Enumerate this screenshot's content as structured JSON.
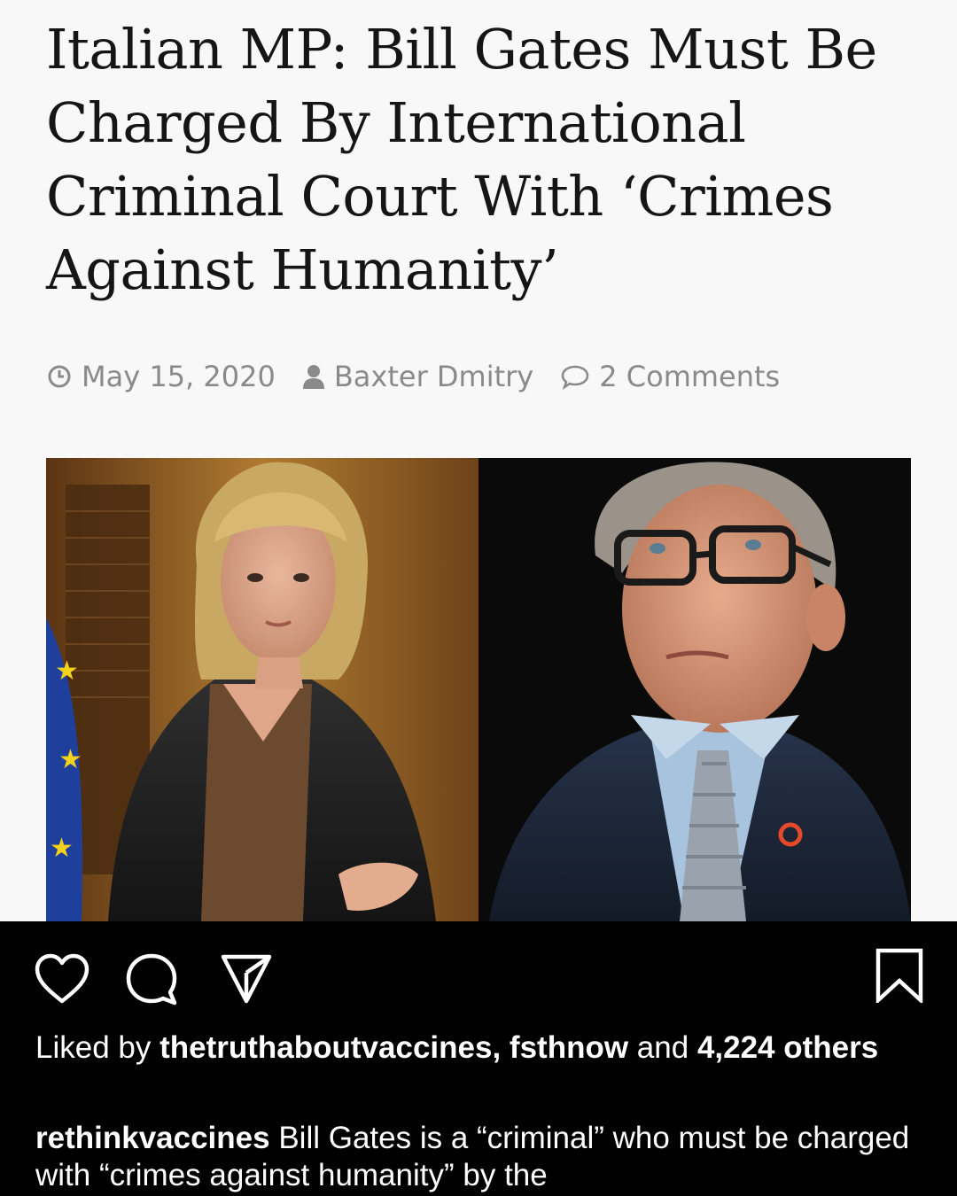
{
  "article": {
    "headline": "Italian MP: Bill Gates Must Be Charged By International Criminal Court With ‘Crimes Against Humanity’",
    "meta": {
      "date": "May 15, 2020",
      "author": "Baxter Dmitry",
      "comments": "2 Comments"
    },
    "photo": {
      "left_subject": "woman-with-blonde-hair",
      "right_subject": "man-with-glasses"
    }
  },
  "instagram": {
    "actions": {
      "like_icon": "heart-icon",
      "comment_icon": "comment-icon",
      "share_icon": "send-icon",
      "save_icon": "bookmark-icon"
    },
    "likes": {
      "prefix": "Liked by",
      "user1": "thetruthaboutvaccines,",
      "user2": "fsthnow",
      "joiner": "and",
      "count": "4,224",
      "suffix": "others"
    },
    "caption": {
      "username": "rethinkvaccines",
      "text": "Bill Gates is a “criminal” who must be charged with “crimes against humanity” by the"
    }
  },
  "colors": {
    "page_bg": "#f8f8f8",
    "meta_text": "#8a8a8a",
    "bar_bg": "#000000",
    "bar_text": "#ffffff"
  }
}
